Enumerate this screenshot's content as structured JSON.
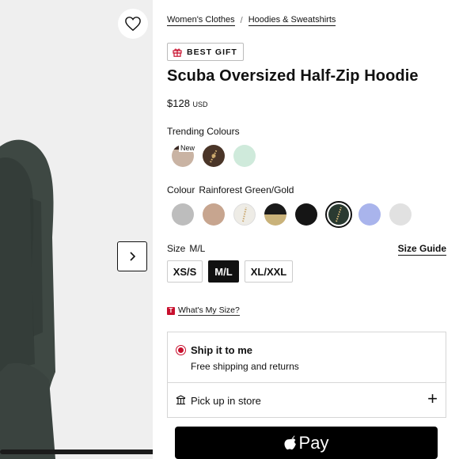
{
  "breadcrumb": {
    "items": [
      "Women's Clothes",
      "Hoodies & Sweatshirts"
    ],
    "separator": "/"
  },
  "badge": {
    "label": "BEST GIFT",
    "icon": "gift-icon"
  },
  "product": {
    "title": "Scuba Oversized Half-Zip Hoodie",
    "price": "$128",
    "currency": "USD"
  },
  "trending": {
    "label": "Trending Colours",
    "new_tag": "New",
    "swatches": [
      {
        "name": "beige-new",
        "color": "#c9b3a3"
      },
      {
        "name": "brown-zip",
        "color": "#4a3528"
      },
      {
        "name": "mint",
        "color": "#cfeadb"
      }
    ]
  },
  "colour": {
    "label": "Colour",
    "selected": "Rainforest Green/Gold",
    "swatches": [
      {
        "name": "heather-grey",
        "color": "#bcbcbc"
      },
      {
        "name": "tan",
        "color": "#c7a58f"
      },
      {
        "name": "white-zip",
        "color": "#eeece6"
      },
      {
        "name": "black-gold",
        "color": "#1a1a1a"
      },
      {
        "name": "black",
        "color": "#151515"
      },
      {
        "name": "rainforest-green-gold",
        "color": "#2a3a31"
      },
      {
        "name": "periwinkle",
        "color": "#a9b4ec"
      },
      {
        "name": "light-grey",
        "color": "#e1e1e1"
      }
    ]
  },
  "size": {
    "label": "Size",
    "selected": "M/L",
    "guide_label": "Size Guide",
    "options": [
      "XS/S",
      "M/L",
      "XL/XXL"
    ],
    "help_link": "What's My Size?",
    "help_icon_letter": "T"
  },
  "fulfilment": {
    "ship_title": "Ship it to me",
    "ship_sub": "Free shipping and returns",
    "pickup_label": "Pick up in store",
    "pickup_expand": "+"
  },
  "checkout": {
    "applepay_label": "Pay"
  },
  "colors": {
    "accent": "#c8102e",
    "black": "#111111"
  }
}
